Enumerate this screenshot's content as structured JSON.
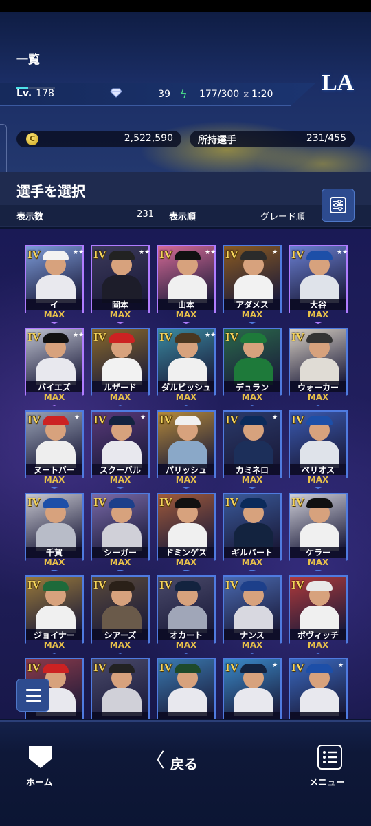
{
  "header": {
    "title": "一覧",
    "team_logo_text": "LA",
    "level_label": "Lv.",
    "level_value": "178",
    "level_progress": 0.3,
    "gems": "39",
    "stamina": "177/300",
    "timer": "1:20",
    "coins": "2,522,590",
    "owned_label": "所持選手",
    "owned_value": "231/455"
  },
  "panel": {
    "title": "選手を選択",
    "count_label": "表示数",
    "count_value": "231",
    "order_label": "表示順",
    "order_value": "グレード順"
  },
  "cards": [
    {
      "grade": "IV",
      "name": "イ",
      "max": "MAX",
      "stars": "★★★★★",
      "frame": "purple",
      "bg": "#7c9bd8",
      "cap": "#f2f2f2",
      "body": "#e9e9ee"
    },
    {
      "grade": "IV",
      "name": "岡本",
      "max": "MAX",
      "stars": "★★★★★",
      "frame": "purple",
      "bg": "#3c3a5a",
      "cap": "#222",
      "body": "#1d1d2a"
    },
    {
      "grade": "IV",
      "name": "山本",
      "max": "MAX",
      "stars": "★★★★★",
      "frame": "purple",
      "bg": "#d46a95",
      "cap": "#111",
      "body": "#f0f0f0"
    },
    {
      "grade": "IV",
      "name": "アダメス",
      "max": "MAX",
      "stars": "★",
      "frame": "blue",
      "bg": "#8a5a20",
      "cap": "#2b2b2b",
      "body": "#f2f2f2"
    },
    {
      "grade": "IV",
      "name": "大谷",
      "max": "MAX",
      "stars": "★★★★★",
      "frame": "purple",
      "bg": "#6a7fd0",
      "cap": "#1d4fa8",
      "body": "#dfe3ea"
    },
    {
      "grade": "IV",
      "name": "バイエズ",
      "max": "MAX",
      "stars": "★★★★★",
      "frame": "purple",
      "bg": "#bfc3d0",
      "cap": "#111",
      "body": "#e8e8ee"
    },
    {
      "grade": "IV",
      "name": "ルザード",
      "max": "MAX",
      "stars": "",
      "frame": "blue",
      "bg": "#8a6a2a",
      "cap": "#c22",
      "body": "#f2f2f2"
    },
    {
      "grade": "IV",
      "name": "ダルビッシュ",
      "max": "MAX",
      "stars": "★★",
      "frame": "blue",
      "bg": "#3a8aa0",
      "cap": "#4a3720",
      "body": "#f0f0f0"
    },
    {
      "grade": "IV",
      "name": "デュラン",
      "max": "MAX",
      "stars": "",
      "frame": "blue",
      "bg": "#2a6a4a",
      "cap": "#1e7a3a",
      "body": "#1e7a3a"
    },
    {
      "grade": "IV",
      "name": "ウォーカー",
      "max": "MAX",
      "stars": "",
      "frame": "blue",
      "bg": "#d7cfc2",
      "cap": "#333",
      "body": "#e0dcd5"
    },
    {
      "grade": "IV",
      "name": "ヌートバー",
      "max": "MAX",
      "stars": "★",
      "frame": "blue",
      "bg": "#9aa3b5",
      "cap": "#c22",
      "body": "#eeeeee"
    },
    {
      "grade": "IV",
      "name": "スクーバル",
      "max": "MAX",
      "stars": "★",
      "frame": "blue",
      "bg": "#5a3a7a",
      "cap": "#13233f",
      "body": "#e8e8ee"
    },
    {
      "grade": "IV",
      "name": "パリッシュ",
      "max": "MAX",
      "stars": "",
      "frame": "blue",
      "bg": "#b58a3a",
      "cap": "#f0f0f0",
      "body": "#8aa8c8"
    },
    {
      "grade": "IV",
      "name": "カミネロ",
      "max": "MAX",
      "stars": "★",
      "frame": "blue",
      "bg": "#2a3a6a",
      "cap": "#0b2a5a",
      "body": "#1c2f5a"
    },
    {
      "grade": "IV",
      "name": "ベリオス",
      "max": "MAX",
      "stars": "",
      "frame": "blue",
      "bg": "#3a5ab0",
      "cap": "#1d4fa8",
      "body": "#dfe3ea"
    },
    {
      "grade": "IV",
      "name": "千賀",
      "max": "MAX",
      "stars": "",
      "frame": "blue",
      "bg": "#c8c8d0",
      "cap": "#1d4fa8",
      "body": "#b8bcc8"
    },
    {
      "grade": "IV",
      "name": "シーガー",
      "max": "MAX",
      "stars": "",
      "frame": "blue",
      "bg": "#7a6aa8",
      "cap": "#1d3f8a",
      "body": "#d0d0d8"
    },
    {
      "grade": "IV",
      "name": "ドミンゲス",
      "max": "MAX",
      "stars": "",
      "frame": "blue",
      "bg": "#a05a3a",
      "cap": "#111",
      "body": "#f0f0f0"
    },
    {
      "grade": "IV",
      "name": "ギルバート",
      "max": "MAX",
      "stars": "",
      "frame": "blue",
      "bg": "#3a5a9a",
      "cap": "#0b2a5a",
      "body": "#13233f"
    },
    {
      "grade": "IV",
      "name": "ケラー",
      "max": "MAX",
      "stars": "",
      "frame": "blue",
      "bg": "#d0d0d8",
      "cap": "#111",
      "body": "#f0f0f0"
    },
    {
      "grade": "IV",
      "name": "ジョイナー",
      "max": "MAX",
      "stars": "",
      "frame": "blue",
      "bg": "#9a7a3a",
      "cap": "#1e6a3a",
      "body": "#f0f0f0"
    },
    {
      "grade": "IV",
      "name": "シアーズ",
      "max": "MAX",
      "stars": "",
      "frame": "blue",
      "bg": "#5a4a3a",
      "cap": "#2a2018",
      "body": "#6a5a4a"
    },
    {
      "grade": "IV",
      "name": "オカート",
      "max": "MAX",
      "stars": "",
      "frame": "blue",
      "bg": "#4a4a6a",
      "cap": "#13233f",
      "body": "#a0a6b8"
    },
    {
      "grade": "IV",
      "name": "ナンス",
      "max": "MAX",
      "stars": "",
      "frame": "blue",
      "bg": "#4a6ab0",
      "cap": "#1d3f8a",
      "body": "#d8d8e0"
    },
    {
      "grade": "IV",
      "name": "ボヴィッチ",
      "max": "MAX",
      "stars": "",
      "frame": "blue",
      "bg": "#b03a3a",
      "cap": "#e8e8e8",
      "body": "#f0f0f0"
    },
    {
      "grade": "IV",
      "name": "",
      "max": "",
      "stars": "",
      "frame": "blue",
      "bg": "#8a3a4a",
      "cap": "#c22",
      "body": "#e8e8ee"
    },
    {
      "grade": "IV",
      "name": "",
      "max": "",
      "stars": "",
      "frame": "blue",
      "bg": "#4a4a6a",
      "cap": "#222",
      "body": "#d0d0d8"
    },
    {
      "grade": "IV",
      "name": "",
      "max": "",
      "stars": "",
      "frame": "blue",
      "bg": "#3a7ab0",
      "cap": "#1e4a2a",
      "body": "#e8e8ee"
    },
    {
      "grade": "IV",
      "name": "",
      "max": "",
      "stars": "★",
      "frame": "blue",
      "bg": "#3a8ac8",
      "cap": "#13233f",
      "body": "#e8e8ee"
    },
    {
      "grade": "IV",
      "name": "",
      "max": "",
      "stars": "★",
      "frame": "blue",
      "bg": "#3a6ac0",
      "cap": "#1d4fa8",
      "body": "#e8e8ee"
    }
  ],
  "bottom_nav": {
    "home_label": "ホーム",
    "back_chevron": "〈",
    "back_label": "戻る",
    "menu_label": "メニュー"
  },
  "icons": {
    "gem": "diamond-icon",
    "stamina": "lightning-icon",
    "timer": "hourglass-icon",
    "coin": "coin-icon",
    "filter": "filter-sliders-icon",
    "menu_fab": "hamburger-icon",
    "home": "home-plate-icon",
    "menu": "list-icon"
  },
  "colors": {
    "accent": "#4f78c8",
    "gold": "#e8c14a",
    "stamina": "#4be08a"
  }
}
